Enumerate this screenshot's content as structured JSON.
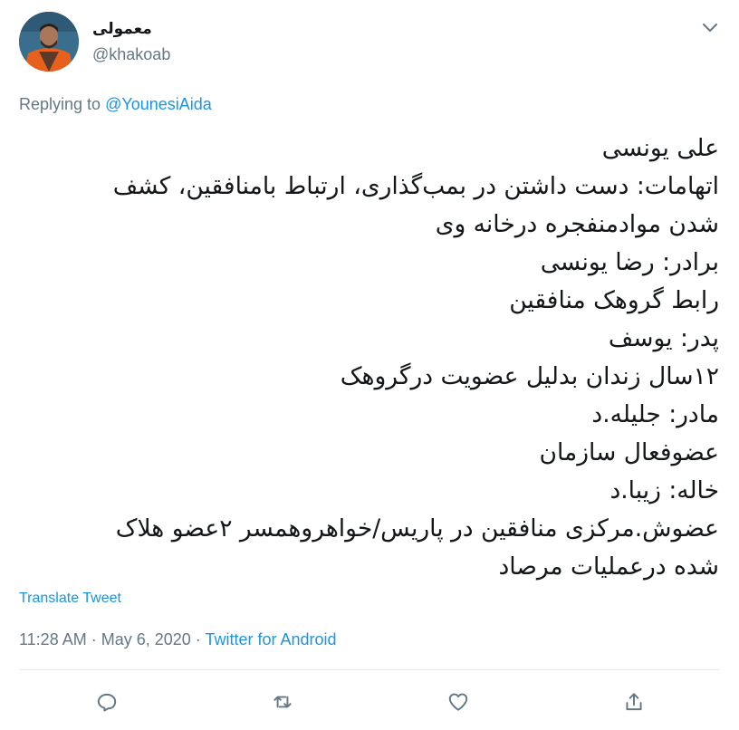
{
  "author": {
    "display_name": "معمولی",
    "handle": "@khakoab"
  },
  "replying": {
    "prefix": "Replying to ",
    "mention": "@YounesiAida"
  },
  "tweet": {
    "lines": [
      "علی یونسی",
      "اتهامات: دست داشتن در بمب‌گذاری، ارتباط بامنافقین، کشف",
      "شدن موادمنفجره درخانه وی",
      "برادر: رضا یونسی",
      "رابط گروهک منافقین",
      "پدر: یوسف",
      "۱۲سال زندان بدلیل عضویت درگروهک",
      "مادر: جلیله.د",
      "عضوفعال سازمان",
      "خاله: زیبا.د",
      "عضوش.مرکزی منافقین در پاریس/خواهروهمسر ۲عضو هلاک",
      "شده درعملیات مرصاد"
    ]
  },
  "translate_label": "Translate Tweet",
  "meta": {
    "time": "11:28 AM",
    "separator": " · ",
    "date": "May 6, 2020",
    "source": "Twitter for Android"
  },
  "icons": {
    "caret": "chevron-down-icon",
    "reply": "reply-icon",
    "retweet": "retweet-icon",
    "like": "heart-icon",
    "share": "share-icon"
  },
  "colors": {
    "link": "#1b95e0",
    "secondary_text": "#657786",
    "primary_text": "#14171a",
    "divider": "#e6ecf0"
  }
}
